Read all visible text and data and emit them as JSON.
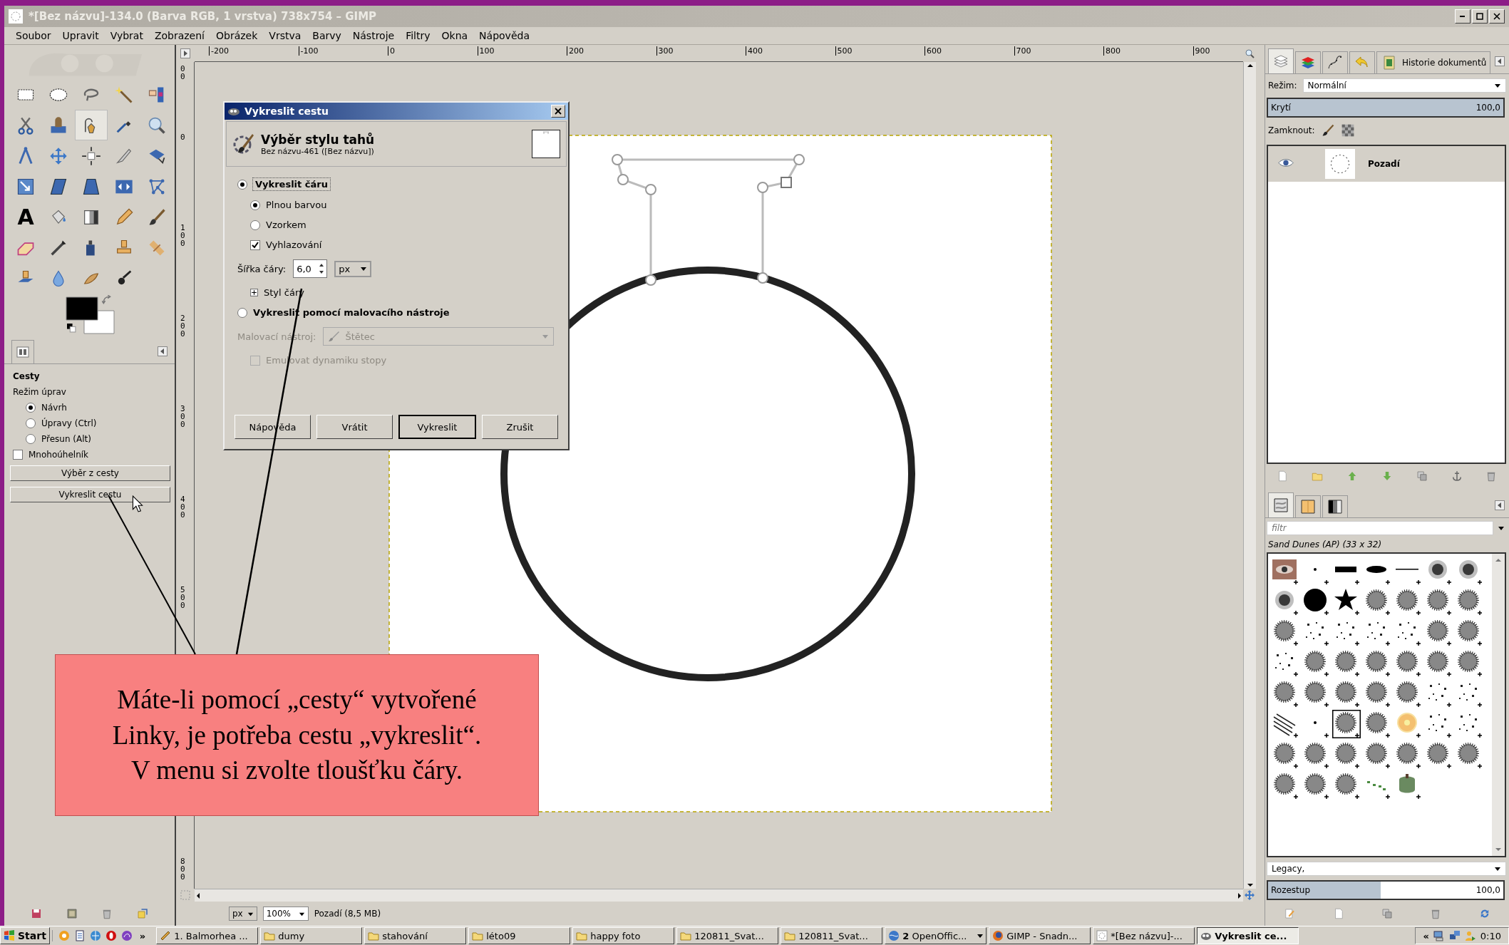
{
  "window": {
    "title": "*[Bez názvu]-134.0 (Barva RGB, 1 vrstva) 738x754 – GIMP"
  },
  "menu": [
    "Soubor",
    "Upravit",
    "Vybrat",
    "Zobrazení",
    "Obrázek",
    "Vrstva",
    "Barvy",
    "Nástroje",
    "Filtry",
    "Okna",
    "Nápověda"
  ],
  "toolbox": {
    "tools": [
      {
        "kind": "rect-select",
        "selected": false
      },
      {
        "kind": "ellipse-select",
        "selected": false
      },
      {
        "kind": "lasso",
        "selected": false
      },
      {
        "kind": "wand",
        "selected": false
      },
      {
        "kind": "color-select",
        "selected": false
      },
      {
        "kind": "scissors",
        "selected": false
      },
      {
        "kind": "foreground-select",
        "selected": false
      },
      {
        "kind": "paths",
        "selected": true
      },
      {
        "kind": "color-picker",
        "selected": false
      },
      {
        "kind": "zoom",
        "selected": false
      },
      {
        "kind": "measure",
        "selected": false
      },
      {
        "kind": "move",
        "selected": false
      },
      {
        "kind": "align",
        "selected": false
      },
      {
        "kind": "crop",
        "selected": false
      },
      {
        "kind": "rotate",
        "selected": false
      },
      {
        "kind": "scale",
        "selected": false
      },
      {
        "kind": "shear",
        "selected": false
      },
      {
        "kind": "perspective",
        "selected": false
      },
      {
        "kind": "flip",
        "selected": false
      },
      {
        "kind": "cage",
        "selected": false
      },
      {
        "kind": "text",
        "label": "A",
        "selected": false
      },
      {
        "kind": "bucket",
        "selected": false
      },
      {
        "kind": "gradient",
        "selected": false
      },
      {
        "kind": "pencil",
        "selected": false
      },
      {
        "kind": "paintbrush",
        "selected": false
      },
      {
        "kind": "eraser",
        "selected": false
      },
      {
        "kind": "airbrush",
        "selected": false
      },
      {
        "kind": "ink",
        "selected": false
      },
      {
        "kind": "clone",
        "selected": false
      },
      {
        "kind": "heal",
        "selected": false
      },
      {
        "kind": "perspective-clone",
        "selected": false
      },
      {
        "kind": "blur",
        "selected": false
      },
      {
        "kind": "smudge",
        "selected": false
      },
      {
        "kind": "dodge",
        "selected": false
      }
    ]
  },
  "tool_options": {
    "title": "Cesty",
    "mode_label": "Režim úprav",
    "modes": [
      {
        "label": "Návrh",
        "selected": true
      },
      {
        "label": "Úpravy (Ctrl)",
        "selected": false
      },
      {
        "label": "Přesun (Alt)",
        "selected": false
      }
    ],
    "polygon": {
      "label": "Mnohoúhelník",
      "checked": false
    },
    "buttons": [
      "Výběr z cesty",
      "Vykreslit cestu"
    ]
  },
  "rulers": {
    "horizontal": [
      "-200",
      "-100",
      "0",
      "100",
      "200",
      "300",
      "400",
      "500",
      "600",
      "700",
      "800",
      "900"
    ],
    "vertical": [
      "00",
      "0",
      "100",
      "200",
      "300",
      "400",
      "500",
      "800"
    ]
  },
  "status_bar": {
    "unit": "px",
    "zoom": "100%",
    "layer_info": "Pozadí (8,5 MB)"
  },
  "dialog": {
    "title": "Vykreslit cestu",
    "heading": "Výběr stylu tahů",
    "subheading": "Bez názvu-461 ([Bez názvu])",
    "options": [
      {
        "label": "Vykreslit čáru",
        "selected": true
      },
      {
        "label": "Vykreslit pomocí malovacího nástroje",
        "selected": false
      }
    ],
    "fill_modes": [
      {
        "label": "Plnou barvou",
        "selected": true
      },
      {
        "label": "Vzorkem",
        "selected": false
      }
    ],
    "antialias": {
      "label": "Vyhlazování",
      "checked": true
    },
    "width": {
      "label": "Šířka čáry:",
      "value": "6,0",
      "unit": "px"
    },
    "line_style": {
      "label": "Styl čáry",
      "expanded": false
    },
    "paint_tool": {
      "label": "Malovací nástroj:",
      "value": "Štětec",
      "disabled": true
    },
    "emulate": {
      "label": "Emulovat dynamiku stopy",
      "checked": false,
      "disabled": true
    },
    "buttons": [
      {
        "label": "Nápověda",
        "default": false
      },
      {
        "label": "Vrátit",
        "default": false
      },
      {
        "label": "Vykreslit",
        "default": true
      },
      {
        "label": "Zrušit",
        "default": false
      }
    ]
  },
  "layers_dock": {
    "tabs": [
      {
        "kind": "layers",
        "selected": true
      },
      {
        "kind": "channels",
        "selected": false
      },
      {
        "kind": "paths",
        "selected": false
      },
      {
        "kind": "undo",
        "selected": false
      },
      {
        "kind": "history",
        "label": "Historie dokumentů",
        "selected": false
      }
    ],
    "mode_label": "Režim:",
    "mode": "Normální",
    "opacity": {
      "label": "Krytí",
      "value": "100,0",
      "level": 1
    },
    "lock_label": "Zamknout:",
    "layers": [
      {
        "name": "Pozadí",
        "visible": true,
        "selected": true
      }
    ]
  },
  "brushes_dock": {
    "tabs": [
      {
        "kind": "brushes",
        "selected": true
      },
      {
        "kind": "patterns",
        "selected": false
      },
      {
        "kind": "gradients",
        "selected": false
      }
    ],
    "filter_placeholder": "filtr",
    "brush_name": "Sand Dunes (AP) (33 x 32)",
    "brushes": [
      {
        "kind": "photo",
        "selected": false
      },
      {
        "kind": "dot",
        "selected": false
      },
      {
        "kind": "bar",
        "selected": false
      },
      {
        "kind": "ellipse",
        "selected": false
      },
      {
        "kind": "line",
        "selected": false
      },
      {
        "kind": "soft",
        "selected": false
      },
      {
        "kind": "soft",
        "selected": false
      },
      {
        "kind": "soft",
        "selected": false
      },
      {
        "kind": "hard",
        "selected": false
      },
      {
        "kind": "star",
        "selected": false
      },
      {
        "kind": "texture",
        "selected": false
      },
      {
        "kind": "texture",
        "selected": false
      },
      {
        "kind": "texture",
        "selected": false
      },
      {
        "kind": "texture",
        "selected": false
      },
      {
        "kind": "texture",
        "selected": false
      },
      {
        "kind": "scatter",
        "selected": false
      },
      {
        "kind": "scatter",
        "selected": false
      },
      {
        "kind": "scatter",
        "selected": false
      },
      {
        "kind": "scatter",
        "selected": false
      },
      {
        "kind": "texture",
        "selected": false
      },
      {
        "kind": "texture",
        "selected": false
      },
      {
        "kind": "scatter",
        "selected": false
      },
      {
        "kind": "texture",
        "selected": false
      },
      {
        "kind": "texture",
        "selected": false
      },
      {
        "kind": "texture",
        "selected": false
      },
      {
        "kind": "texture",
        "selected": false
      },
      {
        "kind": "texture",
        "selected": false
      },
      {
        "kind": "texture",
        "selected": false
      },
      {
        "kind": "texture",
        "selected": false
      },
      {
        "kind": "texture",
        "selected": false
      },
      {
        "kind": "texture",
        "selected": false
      },
      {
        "kind": "texture",
        "selected": false
      },
      {
        "kind": "texture",
        "selected": false
      },
      {
        "kind": "scatter",
        "selected": false
      },
      {
        "kind": "scatter",
        "selected": false
      },
      {
        "kind": "stripes",
        "selected": false
      },
      {
        "kind": "dot",
        "selected": false
      },
      {
        "kind": "texture",
        "selected": true
      },
      {
        "kind": "texture",
        "selected": false
      },
      {
        "kind": "sun",
        "selected": false
      },
      {
        "kind": "scatter",
        "selected": false
      },
      {
        "kind": "scatter",
        "selected": false
      },
      {
        "kind": "texture",
        "selected": false
      },
      {
        "kind": "texture",
        "selected": false
      },
      {
        "kind": "texture",
        "selected": false
      },
      {
        "kind": "texture",
        "selected": false
      },
      {
        "kind": "texture",
        "selected": false
      },
      {
        "kind": "texture",
        "selected": false
      },
      {
        "kind": "texture",
        "selected": false
      },
      {
        "kind": "texture",
        "selected": false
      },
      {
        "kind": "texture",
        "selected": false
      },
      {
        "kind": "texture",
        "selected": false
      },
      {
        "kind": "leaves",
        "selected": false
      },
      {
        "kind": "pepper",
        "selected": false
      }
    ],
    "tag": "Legacy,",
    "spacing": {
      "label": "Rozestup",
      "value": "100,0",
      "level": 0.48
    }
  },
  "callout": {
    "lines": [
      "Máte-li pomocí „cesty“ vytvořené",
      "Linky, je potřeba cestu „vykreslit“.",
      "V menu si zvolte tloušťku čáry."
    ]
  },
  "taskbar": {
    "start": "Start",
    "more": "»",
    "tasks": [
      {
        "kind": "app",
        "label": "1. Balmorhea ...",
        "selected": false
      },
      {
        "kind": "folder",
        "label": "dumy",
        "selected": false
      },
      {
        "kind": "folder",
        "label": "stahování",
        "selected": false
      },
      {
        "kind": "folder",
        "label": "léto09",
        "selected": false
      },
      {
        "kind": "folder",
        "label": "happy foto",
        "selected": false
      },
      {
        "kind": "folder",
        "label": "120811_Svat...",
        "selected": false
      },
      {
        "kind": "folder",
        "label": "120811_Svat...",
        "selected": false
      },
      {
        "kind": "group",
        "label": "**2** OpenOffic...",
        "selected": false
      },
      {
        "kind": "browser",
        "label": "GIMP - Snadn...",
        "selected": false
      },
      {
        "kind": "image",
        "label": "*[Bez názvu]-...",
        "selected": false
      },
      {
        "kind": "gimp",
        "label": "Vykreslit ce...",
        "selected": true
      }
    ],
    "tray_toggle": "«",
    "clock": "0:10"
  }
}
